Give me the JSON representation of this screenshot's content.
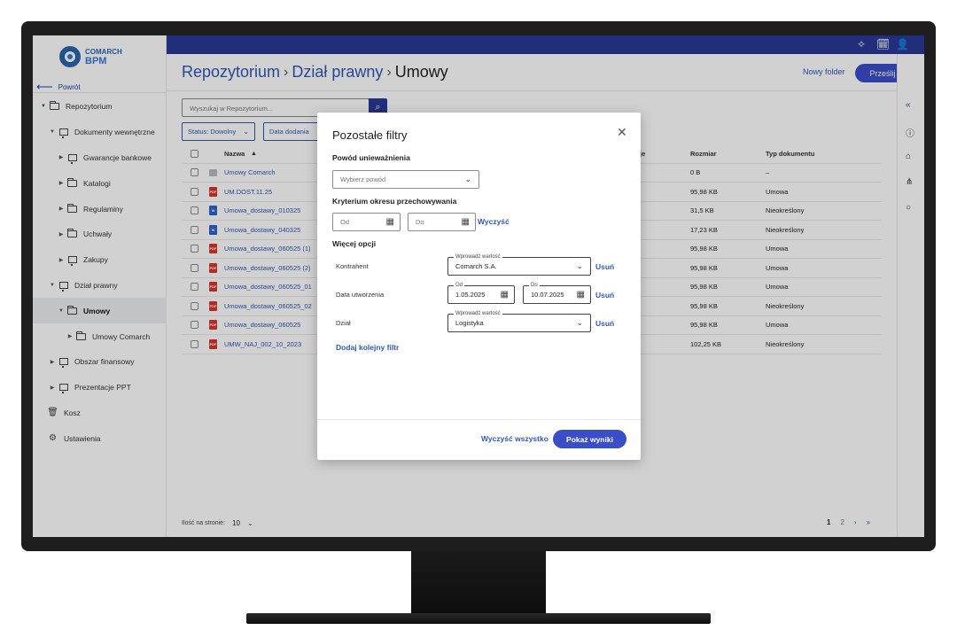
{
  "brand": {
    "line1": "COMARCH",
    "line2": "BPM"
  },
  "sidebar": {
    "back_label": "Powrót",
    "items": [
      {
        "label": "Repozytorium",
        "icon": "folder-open-icon",
        "expanded": true
      },
      {
        "label": "Dokumenty wewnętrzne",
        "icon": "stack-icon",
        "expanded": true
      },
      {
        "label": "Gwarancje bankowe",
        "icon": "stack-icon",
        "expanded": false
      },
      {
        "label": "Katalogi",
        "icon": "folder-icon",
        "expanded": false
      },
      {
        "label": "Regulaminy",
        "icon": "folder-icon",
        "expanded": false
      },
      {
        "label": "Uchwały",
        "icon": "folder-icon",
        "expanded": false
      },
      {
        "label": "Zakupy",
        "icon": "stack-icon",
        "expanded": false
      },
      {
        "label": "Dział prawny",
        "icon": "stack-icon",
        "expanded": true
      },
      {
        "label": "Umowy",
        "icon": "folder-open-icon",
        "expanded": true
      },
      {
        "label": "Umowy Comarch",
        "icon": "folder-icon",
        "expanded": false
      },
      {
        "label": "Obszar finansowy",
        "icon": "stack-icon",
        "expanded": false
      },
      {
        "label": "Prezentacje PPT",
        "icon": "stack-icon",
        "expanded": false
      },
      {
        "label": "Kosz",
        "icon": "trash-icon"
      },
      {
        "label": "Ustawienia",
        "icon": "gear-icon"
      }
    ]
  },
  "header": {
    "breadcrumb": [
      "Repozytorium",
      "Dział prawny",
      "Umowy"
    ],
    "new_folder_label": "Nowy folder",
    "send_label": "Prześlij"
  },
  "toolbar": {
    "search_placeholder": "Wyszukaj w Repozytorium...",
    "chip_status": "Status: Dowolny",
    "chip_date": "Data dodania"
  },
  "table": {
    "col_name": "Nazwa",
    "col_partial": "je",
    "col_size": "Rozmiar",
    "col_type": "Typ dokumentu",
    "rows": [
      {
        "name": "Umowy Comarch",
        "size": "0 B",
        "type": "–",
        "kind": "folder"
      },
      {
        "name": "UM.DOST.11.25",
        "size": "95,98 KB",
        "type": "Umowa",
        "kind": "pdf"
      },
      {
        "name": "Umowa_dostawy_010325",
        "size": "31,5 KB",
        "type": "Nieokreślony",
        "kind": "doc"
      },
      {
        "name": "Umowa_dostawy_040325",
        "size": "17,23 KB",
        "type": "Nieokreślony",
        "kind": "doc"
      },
      {
        "name": "Umowa_dostawy_060525 (1)",
        "size": "95,98 KB",
        "type": "Umowa",
        "kind": "pdf"
      },
      {
        "name": "Umowa_dostawy_060525 (2)",
        "size": "95,98 KB",
        "type": "Umowa",
        "kind": "pdf"
      },
      {
        "name": "Umowa_dostawy_060525_01",
        "size": "95,98 KB",
        "type": "Umowa",
        "kind": "pdf"
      },
      {
        "name": "Umowa_dostawy_060525_02",
        "size": "95,98 KB",
        "type": "Nieokreślony",
        "kind": "pdf"
      },
      {
        "name": "Umowa_dostawy_060525",
        "size": "95,98 KB",
        "type": "Umowa",
        "kind": "pdf"
      },
      {
        "name": "UMW_NAJ_002_10_2023",
        "size": "102,25 KB",
        "type": "Nieokreślony",
        "kind": "pdf"
      }
    ]
  },
  "footer": {
    "per_page_label": "Ilość na stronie:",
    "per_page_value": "10",
    "pages": [
      "1",
      "2"
    ]
  },
  "modal": {
    "title": "Pozostałe filtry",
    "reason_label": "Powód unieważnienia",
    "reason_placeholder": "Wybierz powód",
    "retention_label": "Kryterium okresu przechowywania",
    "from_placeholder": "Od",
    "to_placeholder": "Do",
    "clear_label": "Wyczyść",
    "more_label": "Więcej opcji",
    "rows": [
      {
        "label": "Kontrahent",
        "legend": "Wprowadź wartość",
        "value": "Comarch S.A.",
        "remove": "Usuń"
      },
      {
        "label": "Data utworzenia",
        "from_legend": "Od",
        "from_value": "1.05.2025",
        "to_legend": "Do",
        "to_value": "10.07.2025",
        "remove": "Usuń"
      },
      {
        "label": "Dział",
        "legend": "Wprowadź wartość",
        "value": "Logistyka",
        "remove": "Usuń"
      }
    ],
    "add_filter_label": "Dodaj kolejny filtr",
    "clear_all_label": "Wyczyść wszystko",
    "show_results_label": "Pokaż wyniki"
  },
  "colors": {
    "primary": "#2a3896",
    "accent": "#3a4ec8",
    "link": "#2f58b5",
    "pdf": "#d9342b",
    "doc": "#2a63d0"
  }
}
